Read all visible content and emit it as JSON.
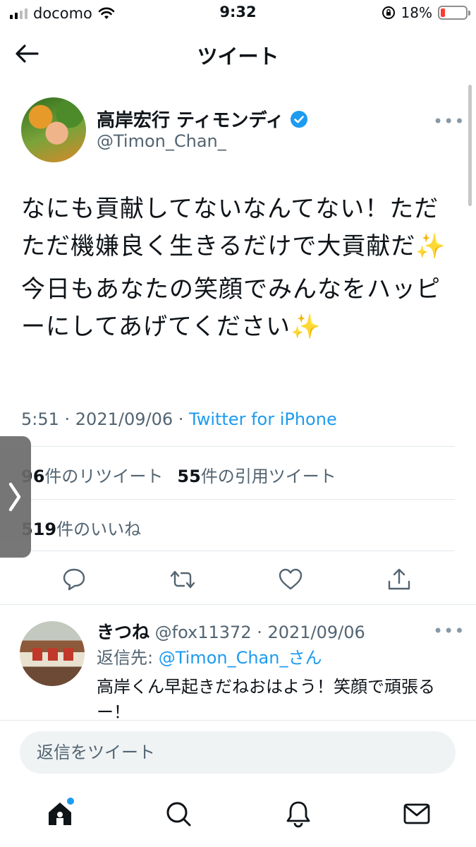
{
  "status_bar": {
    "carrier": "docomo",
    "time": "9:32",
    "battery": "18%",
    "battery_level": 0.18
  },
  "header": {
    "title": "ツイート"
  },
  "tweet": {
    "author_name": "高岸宏行 ティモンディ",
    "author_handle": "@Timon_Chan_",
    "more": "•••",
    "text_p1": "なにも貢献してないなんてない！ただただ機嫌良く生きるだけで大貢献だ✨",
    "text_p2": "今日もあなたの笑顔でみんなをハッピーにしてあげてください✨",
    "timestamp": "5:51 · 2021/09/06 · ",
    "source": "Twitter for iPhone",
    "retweets_count": "96",
    "retweets_label": "件のリツイート",
    "quotes_count": "55",
    "quotes_label": "件の引用ツイート",
    "likes_count": "519",
    "likes_label": "件のいいね"
  },
  "reply": {
    "author_name": "きつね",
    "author_handle_date": " @fox11372 · 2021/09/06",
    "more": "•••",
    "reply_to_label": "返信先: ",
    "reply_to_mention": "@Timon_Chan_さん",
    "text": "高岸くん早起きだねおはよう！笑顔で頑張るー！"
  },
  "compose": {
    "placeholder": "返信をツイート"
  },
  "icons": {
    "back": "back-arrow-icon",
    "verified": "verified-badge-icon",
    "reply": "reply-icon",
    "retweet": "retweet-icon",
    "like": "heart-icon",
    "share": "share-icon",
    "home": "home-icon",
    "search": "search-icon",
    "notifications": "bell-icon",
    "messages": "envelope-icon",
    "side_handle": "chevron-right-icon"
  },
  "colors": {
    "accent": "#1d9bf0",
    "text": "#0f1419",
    "muted": "#536471",
    "battery_low": "#ff3b30"
  }
}
